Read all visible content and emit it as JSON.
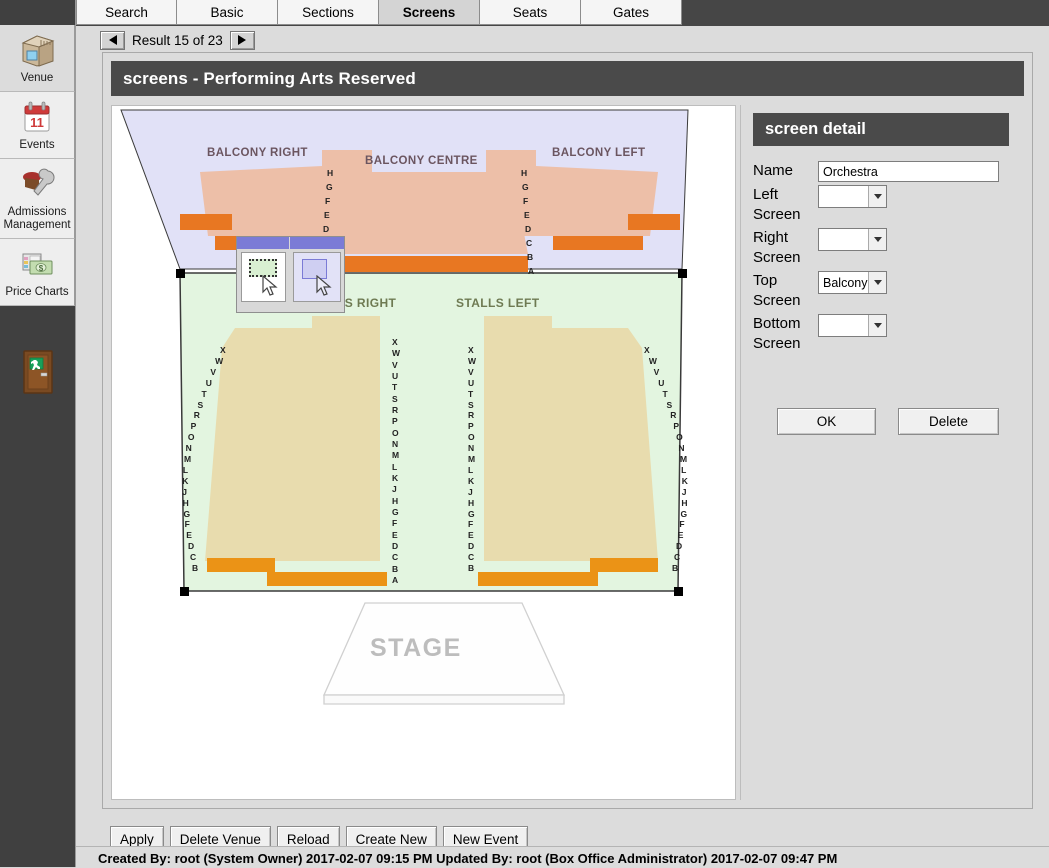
{
  "sidebar": {
    "items": [
      {
        "label": "Venue",
        "icon": "venue-box-icon",
        "selected": true
      },
      {
        "label": "Events",
        "icon": "calendar-icon",
        "selected": false
      },
      {
        "label": "Admissions Management",
        "icon": "wrench-hat-icon",
        "selected": false
      },
      {
        "label": "Price Charts",
        "icon": "money-icon",
        "selected": false
      }
    ],
    "exit_icon": "exit-door-icon"
  },
  "tabs": [
    {
      "label": "Search",
      "active": false
    },
    {
      "label": "Basic",
      "active": false
    },
    {
      "label": "Sections",
      "active": false
    },
    {
      "label": "Screens",
      "active": true
    },
    {
      "label": "Seats",
      "active": false
    },
    {
      "label": "Gates",
      "active": false
    }
  ],
  "result_nav": {
    "prev_icon": "prev-arrow-icon",
    "next_icon": "next-arrow-icon",
    "text": "Result 15 of 23"
  },
  "panel": {
    "title": "screens - Performing Arts Reserved"
  },
  "detail": {
    "title": "screen detail",
    "fields": [
      {
        "label": "Name",
        "type": "text",
        "value": "Orchestra"
      },
      {
        "label": "Left Screen",
        "type": "select",
        "value": ""
      },
      {
        "label": "Right Screen",
        "type": "select",
        "value": ""
      },
      {
        "label": "Top Screen",
        "type": "select",
        "value": "Balcony"
      },
      {
        "label": "Bottom Screen",
        "type": "select",
        "value": ""
      }
    ],
    "ok_label": "OK",
    "delete_label": "Delete"
  },
  "toolbar": {
    "buttons": [
      "Apply",
      "Delete Venue",
      "Reload",
      "Create New",
      "New Event"
    ]
  },
  "status": {
    "text": "Created By: root (System Owner) 2017-02-07 09:15 PM   Updated By: root (Box Office Administrator) 2017-02-07 09:47 PM"
  },
  "seatmap": {
    "balcony": {
      "sections": [
        "BALCONY RIGHT",
        "BALCONY CENTRE",
        "BALCONY LEFT"
      ],
      "row_letters": [
        "H",
        "G",
        "F",
        "E",
        "D",
        "C",
        "B",
        "A"
      ],
      "bg_color": "#e1e1f7",
      "seat_color": "#edbfa8",
      "accent_color": "#e87722"
    },
    "stalls": {
      "sections": [
        "STALLS RIGHT",
        "STALLS LEFT"
      ],
      "outer_row_letters": [
        "X",
        "W",
        "V",
        "U",
        "T",
        "S",
        "R",
        "P",
        "O",
        "N",
        "M",
        "L",
        "K",
        "J",
        "H",
        "G",
        "F",
        "E",
        "D",
        "C",
        "B"
      ],
      "aisle_row_letters": [
        "X",
        "W",
        "V",
        "U",
        "T",
        "S",
        "R",
        "P",
        "O",
        "N",
        "M",
        "L",
        "K",
        "J",
        "H",
        "G",
        "F",
        "E",
        "D",
        "C",
        "B",
        "A"
      ],
      "bg_color": "#e3f5e0",
      "seat_color": "#e8dcae",
      "accent_color": "#eb9316",
      "selected": true
    },
    "stage": {
      "label": "STAGE"
    }
  }
}
